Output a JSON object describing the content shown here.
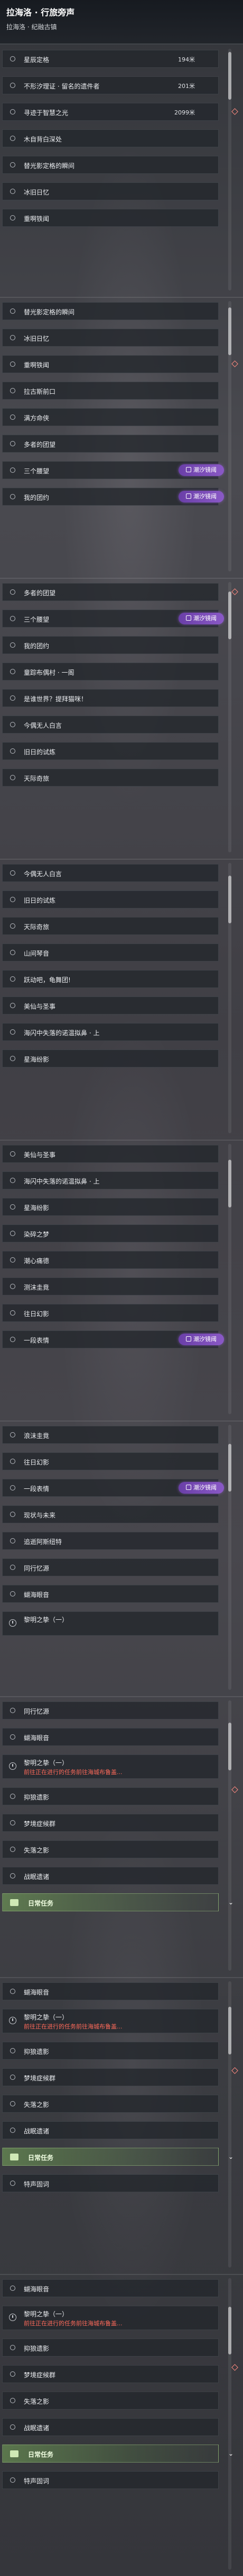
{
  "header": {
    "title": "拉海洛 · 行旅旁声",
    "subtitle": "拉海洛 · 纪融古镇"
  },
  "badge_text": "潮汐镜阈",
  "shots": [
    {
      "rows": [
        {
          "label": "星辰定格",
          "dist": "194米"
        },
        {
          "label": "不形汐理证 · 留名的遗件者",
          "dist": "201米"
        },
        {
          "label": "寻迹于智慧之光",
          "dist": "2099米"
        },
        {
          "label": "木自背白深处",
          "dist": ""
        },
        {
          "label": "替光影定格的瞬间",
          "dist": ""
        },
        {
          "label": "冰旧日忆",
          "dist": ""
        },
        {
          "label": "重啊铁闻",
          "dist": ""
        }
      ]
    },
    {
      "rows": [
        {
          "label": "替光影定格的瞬间",
          "dist": ""
        },
        {
          "label": "冰旧日忆",
          "dist": ""
        },
        {
          "label": "重啊铁闻",
          "dist": ""
        },
        {
          "label": "拉古斯前口",
          "dist": ""
        },
        {
          "label": "满方命侠",
          "dist": ""
        },
        {
          "label": "多者的团望",
          "dist": ""
        },
        {
          "label": "三个腰望",
          "dist": ""
        },
        {
          "label": "我的团约",
          "dist": ""
        }
      ]
    },
    {
      "rows": [
        {
          "label": "多者的团望",
          "dist": ""
        },
        {
          "label": "三个腰望",
          "dist": ""
        },
        {
          "label": "我的团约",
          "dist": ""
        },
        {
          "label": "童踪布偶村 · 一阁",
          "dist": ""
        },
        {
          "label": "是谁世界？提拜猫咪！",
          "dist": ""
        },
        {
          "label": "今偶无人白言",
          "dist": ""
        },
        {
          "label": "旧日的试炼",
          "dist": ""
        },
        {
          "label": "天际奇旅",
          "dist": ""
        }
      ]
    },
    {
      "rows": [
        {
          "label": "今偶无人白言",
          "dist": ""
        },
        {
          "label": "旧日的试炼",
          "dist": ""
        },
        {
          "label": "天际奇旅",
          "dist": ""
        },
        {
          "label": "山间琴音",
          "dist": ""
        },
        {
          "label": "跃动吧，龟舞团!",
          "dist": ""
        },
        {
          "label": "美仙与圣事",
          "dist": ""
        },
        {
          "label": "海闪中失落的诺温拟鼻 · 上",
          "dist": ""
        },
        {
          "label": "星海纷影",
          "dist": ""
        }
      ]
    },
    {
      "rows": [
        {
          "label": "美仙与圣事",
          "dist": ""
        },
        {
          "label": "海闪中失落的诺温拟鼻 · 上",
          "dist": ""
        },
        {
          "label": "星海纷影",
          "dist": ""
        },
        {
          "label": "染碎之梦",
          "dist": ""
        },
        {
          "label": "潮心痛德",
          "dist": ""
        },
        {
          "label": "测沫圭竟",
          "dist": ""
        },
        {
          "label": "往日幻影",
          "dist": ""
        },
        {
          "label": "一段表情",
          "dist": ""
        }
      ]
    },
    {
      "rows": [
        {
          "label": "浪沫圭竟",
          "dist": ""
        },
        {
          "label": "往日幻影",
          "dist": ""
        },
        {
          "label": "一段表情",
          "dist": ""
        },
        {
          "label": "现状与未来",
          "dist": ""
        },
        {
          "label": "追逝阿斯纽特",
          "dist": ""
        },
        {
          "label": "同行忆源",
          "dist": ""
        },
        {
          "label": "蝴海眼音",
          "dist": ""
        }
      ],
      "tall": {
        "label": "黎明之挚（一）",
        "warn": ""
      }
    },
    {
      "rows_top": [
        {
          "label": "同行忆源",
          "dist": ""
        },
        {
          "label": "蝴海眼音",
          "dist": ""
        }
      ],
      "tall": {
        "label": "黎明之挚（一）",
        "warn": "前往正在进行的任务前往海城布鲁盖..."
      },
      "rows_bottom": [
        {
          "label": "抑狼遗影",
          "dist": ""
        },
        {
          "label": "梦境症候群",
          "dist": ""
        },
        {
          "label": "失落之影",
          "dist": ""
        },
        {
          "label": "战眠遗诸",
          "dist": ""
        }
      ],
      "section": "日常任务"
    },
    {
      "rows_top": [
        {
          "label": "蝴海眼音",
          "dist": ""
        }
      ],
      "tall": {
        "label": "黎明之挚（一）",
        "warn": "前往正在进行的任务前往海城布鲁盖..."
      },
      "rows_bottom": [
        {
          "label": "抑狼遗影",
          "dist": ""
        },
        {
          "label": "梦境症候群",
          "dist": ""
        },
        {
          "label": "失落之影",
          "dist": ""
        },
        {
          "label": "战眠遗诸",
          "dist": ""
        }
      ],
      "section": "日常任务",
      "after": [
        {
          "label": "特声固词",
          "dist": ""
        }
      ]
    },
    {
      "rows_top": [
        {
          "label": "蝴海眼音",
          "dist": ""
        }
      ],
      "tall": {
        "label": "黎明之挚（一）",
        "warn": "前往正在进行的任务前往海城布鲁盖..."
      },
      "rows_bottom": [
        {
          "label": "抑狼遗影",
          "dist": ""
        },
        {
          "label": "梦境症候群",
          "dist": ""
        },
        {
          "label": "失落之影",
          "dist": ""
        },
        {
          "label": "战眠遗诸",
          "dist": ""
        }
      ],
      "section": "日常任务",
      "after": [
        {
          "label": "特声固词",
          "dist": ""
        }
      ]
    }
  ]
}
